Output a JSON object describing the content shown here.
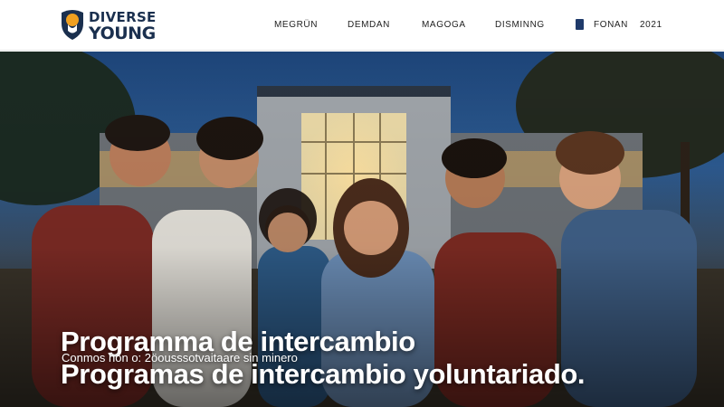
{
  "brand": {
    "line1": "DIVERSE",
    "line2": "YOUNG"
  },
  "nav": {
    "items": [
      "MEGRÜN",
      "DEMDAN",
      "MAGOGA",
      "DISMINNG"
    ],
    "language": "FONAN",
    "year": "2021"
  },
  "hero": {
    "title_line1": "Programma de intercambio",
    "title_line2": "Programas de intercambio yoluntariado.",
    "subtitle": "Conmos hon o: 2öousssotvaitaare sin minero"
  },
  "colors": {
    "brand_navy": "#1a2f4e",
    "brand_orange": "#f0a020",
    "header_bg": "#ffffff"
  }
}
